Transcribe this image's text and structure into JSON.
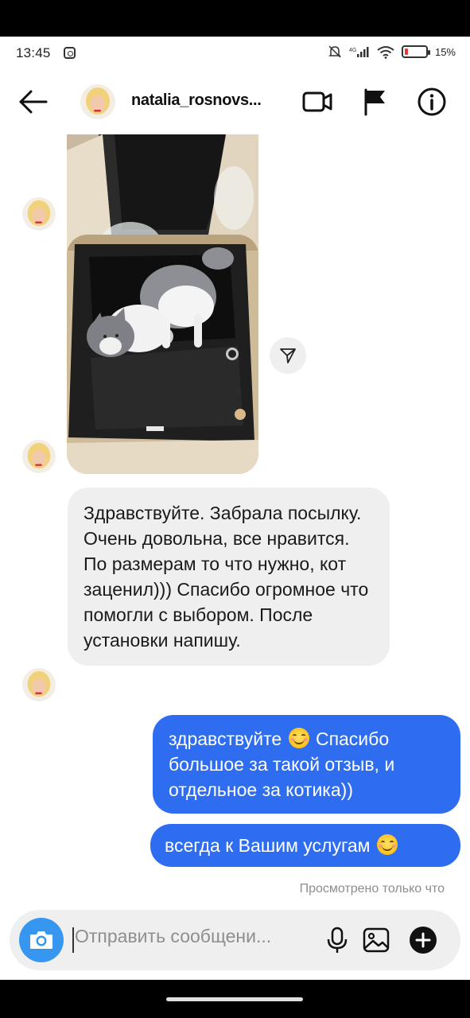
{
  "status_bar": {
    "time": "13:45",
    "battery_text": "15%",
    "battery_level": 0.15
  },
  "header": {
    "username": "natalia_rosnovs..."
  },
  "messages": {
    "incoming_text": "Здравствуйте. Забрала посылку. Очень довольна, все нравится. По размерам то что нужно, кот заценил))) Спасибо огромное что помогли с выбором. После установки напишу.",
    "outgoing_1": {
      "line1_a": "здравствуйте",
      "line1_b": "Спасибо",
      "line2": "большое за такой отзыв, и",
      "line3": "отдельное за котика))"
    },
    "outgoing_2": {
      "text": "всегда к Вашим услугам"
    },
    "seen_status": "Просмотрено только что"
  },
  "composer": {
    "placeholder": "Отправить сообщени..."
  },
  "icons": {
    "back": "arrow-left-icon",
    "video": "video-camera-icon",
    "report": "flag-icon",
    "info": "info-icon",
    "share": "send-icon",
    "camera": "camera-icon",
    "mic": "microphone-icon",
    "gallery": "gallery-icon",
    "more": "plus-icon"
  },
  "colors": {
    "outgoing_bubble": "#2f6df0",
    "incoming_bubble": "#efefef",
    "camera_button": "#3797f0"
  }
}
